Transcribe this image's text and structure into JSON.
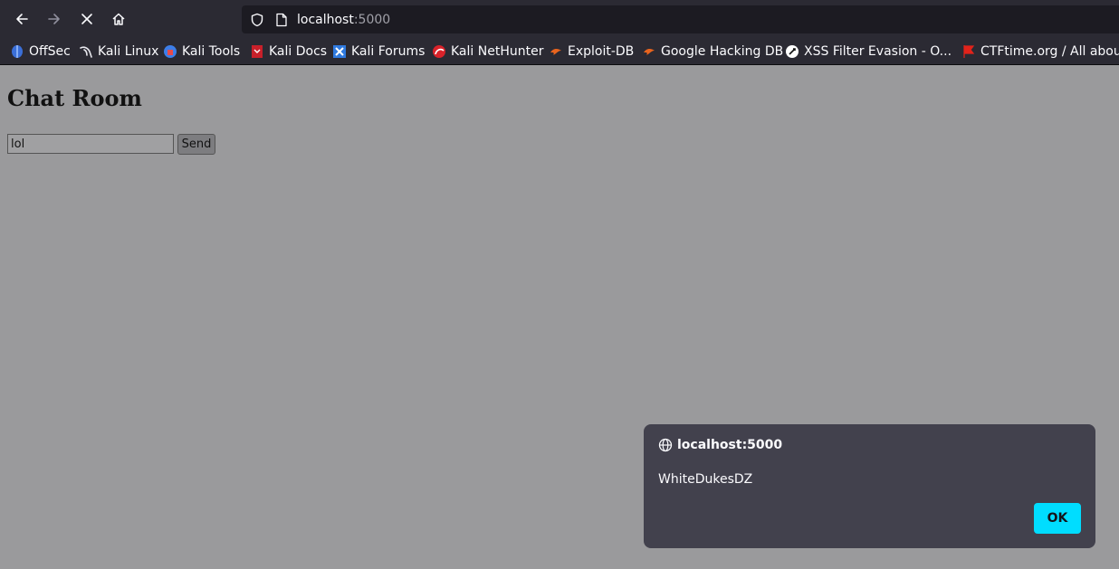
{
  "browser": {
    "url_host": "localhost",
    "url_port": ":5000",
    "accent": "#00ddff",
    "bookmarks": [
      {
        "label": "OffSec",
        "icon": "offsec-icon"
      },
      {
        "label": "Kali Linux",
        "icon": "kali-dragon-icon"
      },
      {
        "label": "Kali Tools",
        "icon": "kali-tools-icon"
      },
      {
        "label": "Kali Docs",
        "icon": "kali-docs-icon"
      },
      {
        "label": "Kali Forums",
        "icon": "kali-forums-icon"
      },
      {
        "label": "Kali NetHunter",
        "icon": "nethunter-icon"
      },
      {
        "label": "Exploit-DB",
        "icon": "exploit-db-icon"
      },
      {
        "label": "Google Hacking DB",
        "icon": "ghdb-icon"
      },
      {
        "label": "XSS Filter Evasion - O...",
        "icon": "owasp-icon"
      },
      {
        "label": "CTFtime.org / All abou...",
        "icon": "ctftime-icon"
      }
    ]
  },
  "page": {
    "title": "Chat Room",
    "input_value": "lol",
    "send_label": "Send"
  },
  "dialog": {
    "origin": "localhost:5000",
    "message": "WhiteDukesDZ",
    "ok_label": "OK"
  }
}
